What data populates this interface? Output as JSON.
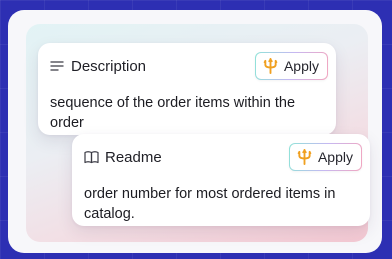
{
  "cards": [
    {
      "icon": "align-left-icon",
      "title": "Description",
      "apply_label": "Apply",
      "text": "sequence of the order items within the order"
    },
    {
      "icon": "book-icon",
      "title": "Readme",
      "apply_label": "Apply",
      "text": "order number for most ordered items in catalog."
    }
  ],
  "colors": {
    "background": "#2d2fb3",
    "panel": "#f7f7fa",
    "trident": "#f0a020",
    "text": "#1c1c22"
  }
}
